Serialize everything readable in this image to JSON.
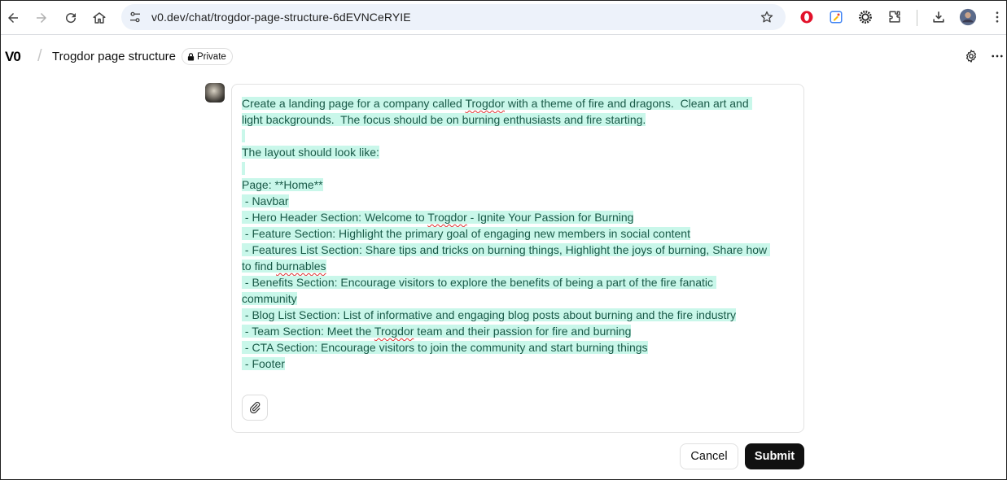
{
  "browser": {
    "url": "v0.dev/chat/trogdor-page-structure-6dEVNCeRYIE",
    "icons": [
      "back-arrow-icon",
      "forward-arrow-icon",
      "reload-icon",
      "home-icon",
      "site-settings-icon",
      "bookmark-star-icon",
      "opera-extension-icon",
      "color-picker-extension-icon",
      "gear-extension-icon",
      "puzzle-extensions-icon",
      "download-icon",
      "profile-avatar-icon",
      "kebab-menu-icon"
    ]
  },
  "app": {
    "logo": "V0",
    "title": "Trogdor page structure",
    "visibility": "Private"
  },
  "prompt": {
    "lines": [
      [
        {
          "t": "Create a landing page for a company called "
        },
        {
          "t": "Trogdor",
          "sp": true
        },
        {
          "t": " with a theme of fire and dragons.  Clean art and "
        }
      ],
      [
        {
          "t": "light backgrounds.  The focus should be on burning enthusiasts and fire starting."
        }
      ],
      [
        {
          "t": " "
        }
      ],
      [
        {
          "t": "The layout should look like:"
        }
      ],
      [
        {
          "t": " "
        }
      ],
      [
        {
          "t": "Page: **Home**"
        }
      ],
      [
        {
          "t": " - Navbar"
        }
      ],
      [
        {
          "t": " - Hero Header Section: Welcome to "
        },
        {
          "t": "Trogdor",
          "sp": true
        },
        {
          "t": " - Ignite Your Passion for Burning"
        }
      ],
      [
        {
          "t": " - Feature Section: Highlight the primary goal of engaging new members in social content"
        }
      ],
      [
        {
          "t": " - Features List Section: Share tips and tricks on burning things, Highlight the joys of burning, Share how "
        }
      ],
      [
        {
          "t": "to find "
        },
        {
          "t": "burnables",
          "sp": true
        }
      ],
      [
        {
          "t": " - Benefits Section: Encourage visitors to explore the benefits of being a part of the fire fanatic "
        }
      ],
      [
        {
          "t": "community"
        }
      ],
      [
        {
          "t": " - Blog List Section: List of informative and engaging blog posts about burning and the fire industry"
        }
      ],
      [
        {
          "t": " - Team Section: Meet the "
        },
        {
          "t": "Trogdor",
          "sp": true
        },
        {
          "t": " team and their passion for fire and burning"
        }
      ],
      [
        {
          "t": " - CTA Section: Encourage visitors to join the community and start burning things"
        }
      ],
      [
        {
          "t": " - Footer"
        }
      ]
    ]
  },
  "actions": {
    "cancel_label": "Cancel",
    "submit_label": "Submit"
  },
  "colors": {
    "highlight": "#c9f7ea",
    "prompt_text": "#1a5a48",
    "submit_bg": "#111111",
    "address_bg": "#edf2fa"
  }
}
